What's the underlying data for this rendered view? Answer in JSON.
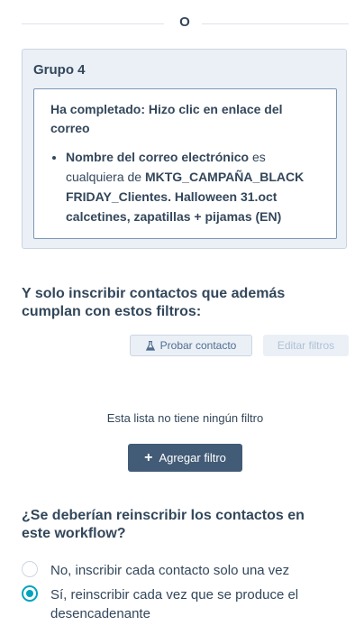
{
  "divider": {
    "or_label": "O"
  },
  "group": {
    "title": "Grupo 4",
    "filter_title": "Ha completado: Hizo clic en enlace del correo",
    "criteria": {
      "property": "Nombre del correo electrónico",
      "operator": "es cualquiera de",
      "value": "MKTG_CAMPAÑA_BLACK FRIDAY_Clientes. Halloween 31.oct calcetines, zapatillas + pijamas (EN)"
    }
  },
  "filters_section": {
    "heading": "Y solo inscribir contactos que además cumplan con estos filtros:",
    "test_contact_label": "Probar contacto",
    "edit_filters_label": "Editar filtros",
    "empty_text": "Esta lista no tiene ningún filtro",
    "add_filter_label": "Agregar filtro"
  },
  "reenroll_section": {
    "heading": "¿Se deberían reinscribir los contactos en este workflow?",
    "options": [
      {
        "label": "No, inscribir cada contacto solo una vez",
        "checked": false
      },
      {
        "label": "Sí, reinscribir cada vez que se produce el desencadenante",
        "checked": true
      }
    ]
  },
  "colors": {
    "accent": "#00a4bd",
    "primary_button": "#425b76",
    "group_background": "#eaf0f6",
    "text": "#33475b"
  },
  "icons": [
    "flask-icon",
    "plus-icon",
    "radio-icon"
  ]
}
